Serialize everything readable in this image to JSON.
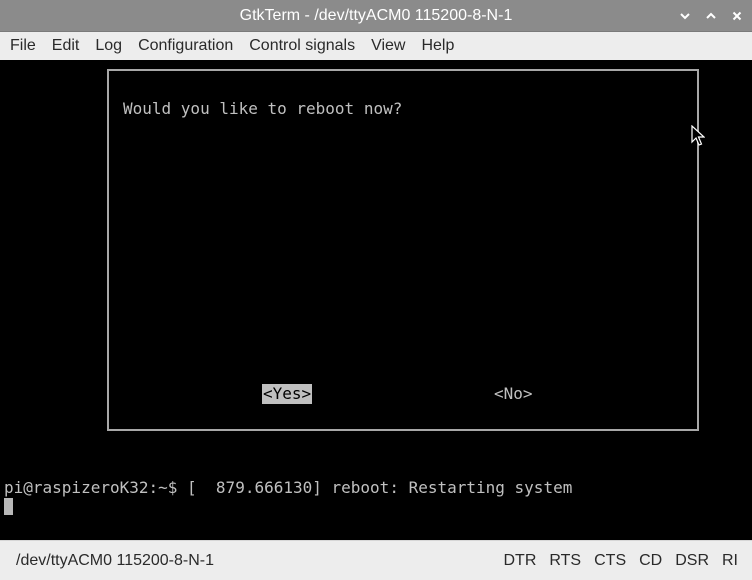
{
  "window": {
    "title": "GtkTerm - /dev/ttyACM0  115200-8-N-1"
  },
  "menubar": {
    "items": [
      {
        "label": "File"
      },
      {
        "label": "Edit"
      },
      {
        "label": "Log"
      },
      {
        "label": "Configuration"
      },
      {
        "label": "Control signals"
      },
      {
        "label": "View"
      },
      {
        "label": "Help"
      }
    ]
  },
  "terminal": {
    "dialog": {
      "question": "Would you like to reboot now?",
      "yes_label": "<Yes>",
      "no_label": "<No>",
      "selected": "yes"
    },
    "lines": [
      "pi@raspizeroK32:~$ [  879.666130] reboot: Restarting system"
    ]
  },
  "statusbar": {
    "port": "/dev/ttyACM0  115200-8-N-1",
    "signals": [
      "DTR",
      "RTS",
      "CTS",
      "CD",
      "DSR",
      "RI"
    ]
  },
  "colors": {
    "titlebar": "#8b8b8b",
    "terminal_bg": "#000000",
    "terminal_fg": "#c0c0c0",
    "dialog_border": "#a8a8a8"
  },
  "icons": {
    "minimize": "chevron-down-icon",
    "maximize": "chevron-up-icon",
    "close": "close-icon",
    "pointer": "mouse-pointer-icon"
  }
}
